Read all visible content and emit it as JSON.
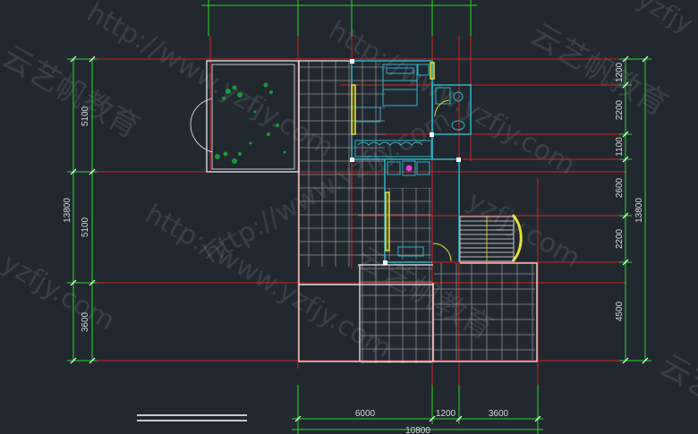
{
  "dimensions": {
    "left_segments": [
      "5100",
      "5100",
      "3600"
    ],
    "left_total": "13800",
    "right_segments": [
      "1200",
      "2200",
      "1100",
      "2600",
      "2200",
      "4500"
    ],
    "right_total": "13800",
    "bottom_segments": [
      "6000",
      "1200",
      "3600"
    ],
    "bottom_total": "10800"
  },
  "watermarks": {
    "url": "http://www.yzfjy.com",
    "url_short": "yzfjy.com",
    "brand": "云艺帆教育",
    "brand_short": "云艺",
    "brand_top": "yzfjy"
  },
  "colors": {
    "background": "#212830",
    "dimension_line": "#1fe01f",
    "axis_line": "#e01f1f",
    "wall": "#ffffff",
    "tile": "#a9a9a9",
    "furniture": "#2cb5c8",
    "door": "#e8e030",
    "plant": "#1a9a3a",
    "magenta_accent": "#e040e0"
  }
}
